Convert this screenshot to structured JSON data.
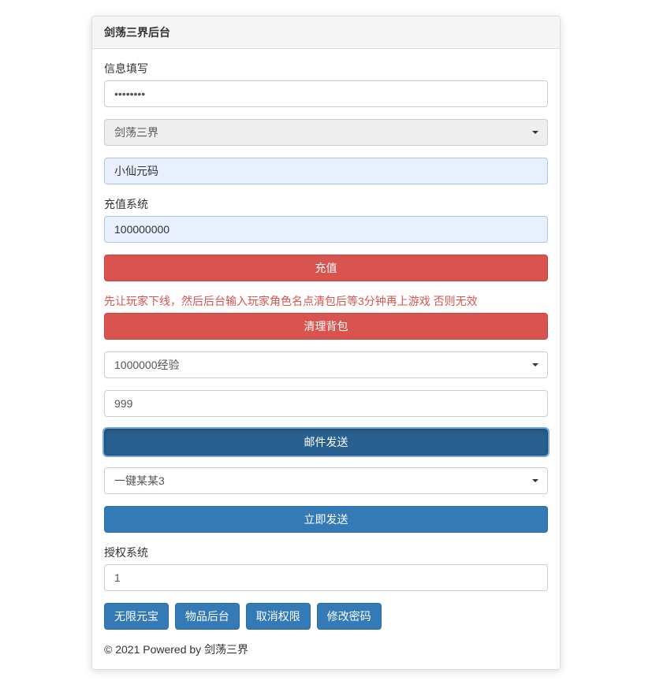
{
  "panel": {
    "title": "剑荡三界后台"
  },
  "info": {
    "label": "信息填写",
    "password_value": "••••••••"
  },
  "server_select": {
    "selected": "剑荡三界"
  },
  "character_input": {
    "value": "小仙元码"
  },
  "recharge": {
    "label": "充值系统",
    "value": "100000000",
    "button": "充值"
  },
  "bag": {
    "warning": "先让玩家下线，然后后台输入玩家角色名点清包后等3分钟再上游戏 否则无效",
    "button": "清理背包"
  },
  "item_select": {
    "selected": "1000000经验"
  },
  "quantity": {
    "value": "999"
  },
  "mail": {
    "button": "邮件发送"
  },
  "oneclick_select": {
    "selected": "一键某某3"
  },
  "send": {
    "button": "立即发送"
  },
  "auth": {
    "label": "授权系统",
    "value": "1"
  },
  "buttons": {
    "unlimited": "无限元宝",
    "item_backend": "物品后台",
    "revoke": "取消权限",
    "change_pwd": "修改密码"
  },
  "footer": "© 2021 Powered by 剑荡三界"
}
